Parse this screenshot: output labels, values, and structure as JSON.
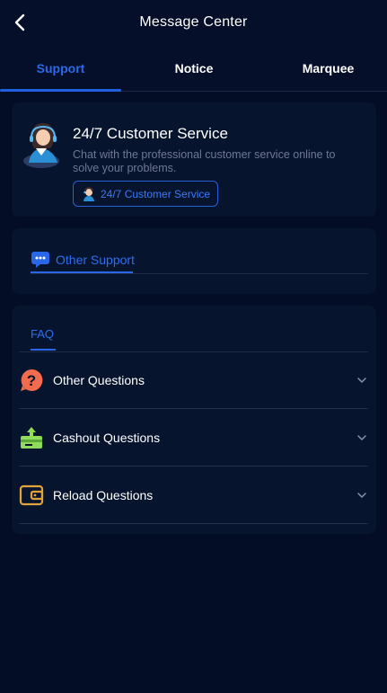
{
  "header": {
    "title": "Message Center"
  },
  "tabs": [
    {
      "label": "Support",
      "active": true
    },
    {
      "label": "Notice",
      "active": false
    },
    {
      "label": "Marquee",
      "active": false
    }
  ],
  "customer_service": {
    "title": "24/7 Customer Service",
    "description": "Chat with the professional customer service online to solve your problems.",
    "button_label": "24/7 Customer Service"
  },
  "other_support": {
    "label": "Other Support"
  },
  "faq": {
    "label": "FAQ",
    "items": [
      {
        "label": "Other Questions",
        "icon": "question-icon"
      },
      {
        "label": "Cashout Questions",
        "icon": "cashout-icon"
      },
      {
        "label": "Reload Questions",
        "icon": "wallet-icon"
      }
    ]
  },
  "colors": {
    "background": "#030d26",
    "card": "#07142e",
    "accent": "#2a6ae8",
    "muted_text": "#6d7896"
  }
}
